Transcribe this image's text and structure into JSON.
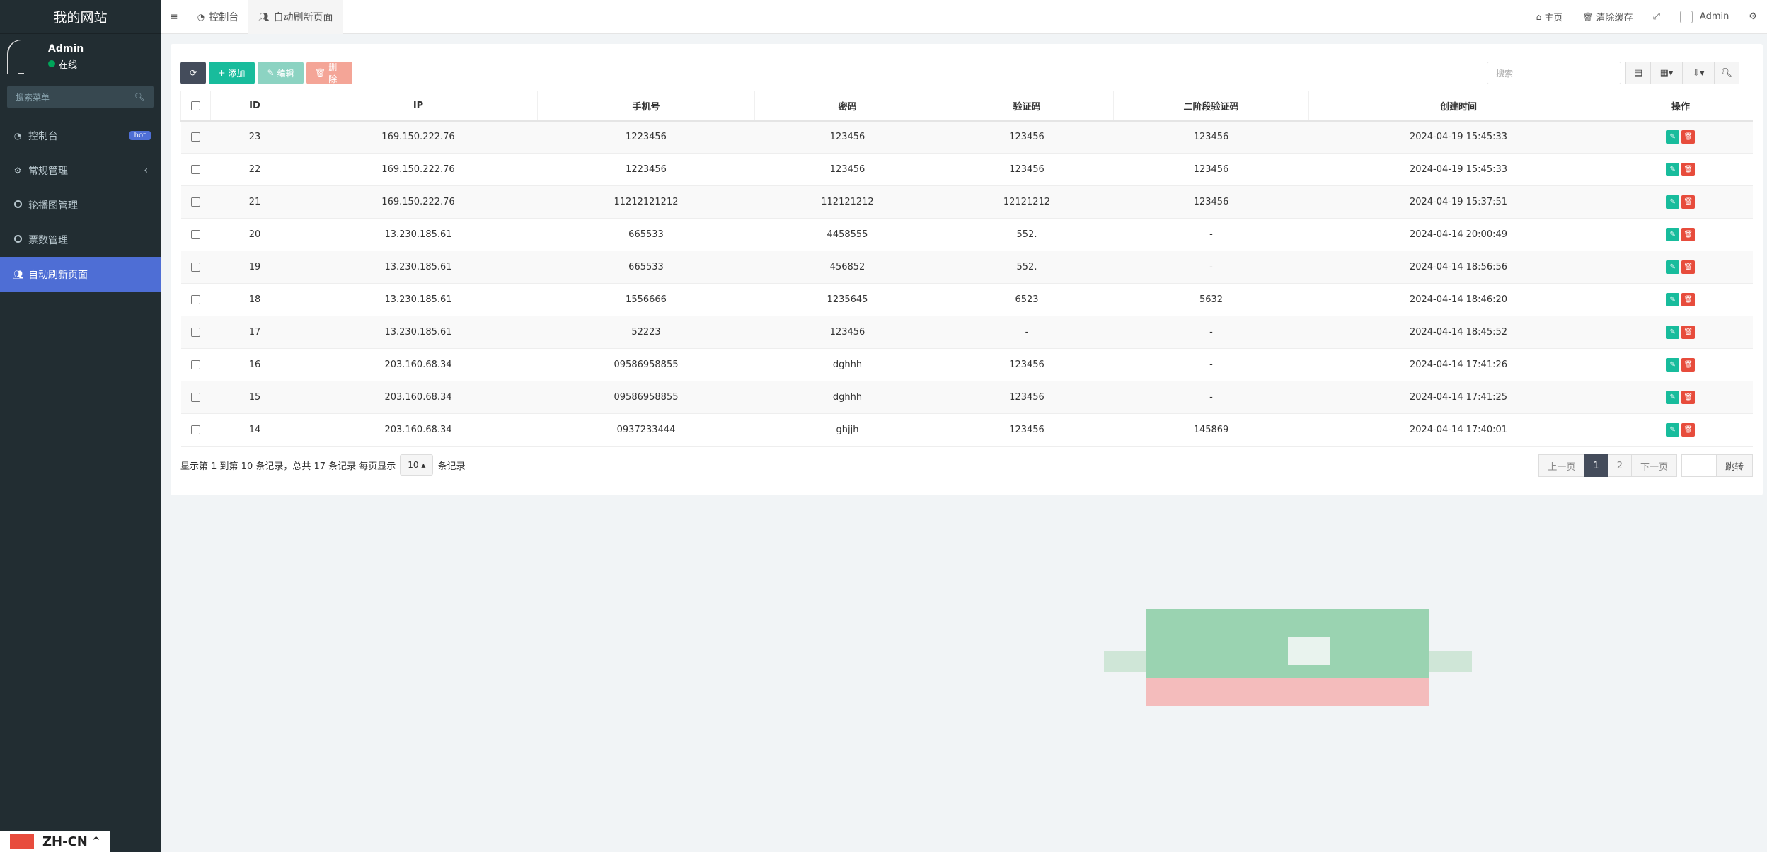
{
  "sidebar": {
    "brand": "我的网站",
    "user": {
      "name": "Admin",
      "status": "在线"
    },
    "search_placeholder": "搜索菜单",
    "items": [
      {
        "label": "控制台",
        "badge": "hot"
      },
      {
        "label": "常规管理"
      },
      {
        "label": "轮播图管理"
      },
      {
        "label": "票数管理"
      },
      {
        "label": "自动刷新页面"
      }
    ],
    "lang": "ZH-CN"
  },
  "topbar": {
    "tabs": [
      {
        "label": "控制台"
      },
      {
        "label": "自动刷新页面"
      }
    ],
    "home": "主页",
    "clear_cache": "清除缓存",
    "user": "Admin"
  },
  "toolbar": {
    "add": "添加",
    "edit": "编辑",
    "delete": "删除",
    "search_placeholder": "搜索"
  },
  "table": {
    "headers": [
      "ID",
      "IP",
      "手机号",
      "密码",
      "验证码",
      "二阶段验证码",
      "创建时间",
      "操作"
    ],
    "rows": [
      [
        "23",
        "169.150.222.76",
        "1223456",
        "123456",
        "123456",
        "123456",
        "2024-04-19 15:45:33"
      ],
      [
        "22",
        "169.150.222.76",
        "1223456",
        "123456",
        "123456",
        "123456",
        "2024-04-19 15:45:33"
      ],
      [
        "21",
        "169.150.222.76",
        "11212121212",
        "112121212",
        "12121212",
        "123456",
        "2024-04-19 15:37:51"
      ],
      [
        "20",
        "13.230.185.61",
        "665533",
        "4458555",
        "552.",
        "-",
        "2024-04-14 20:00:49"
      ],
      [
        "19",
        "13.230.185.61",
        "665533",
        "456852",
        "552.",
        "-",
        "2024-04-14 18:56:56"
      ],
      [
        "18",
        "13.230.185.61",
        "1556666",
        "1235645",
        "6523",
        "5632",
        "2024-04-14 18:46:20"
      ],
      [
        "17",
        "13.230.185.61",
        "52223",
        "123456",
        "-",
        "-",
        "2024-04-14 18:45:52"
      ],
      [
        "16",
        "203.160.68.34",
        "09586958855",
        "dghhh",
        "123456",
        "-",
        "2024-04-14 17:41:26"
      ],
      [
        "15",
        "203.160.68.34",
        "09586958855",
        "dghhh",
        "123456",
        "-",
        "2024-04-14 17:41:25"
      ],
      [
        "14",
        "203.160.68.34",
        "0937233444",
        "ghjjh",
        "123456",
        "145869",
        "2024-04-14 17:40:01"
      ]
    ]
  },
  "footer": {
    "summary": "显示第 1 到第 10 条记录，总共 17 条记录 每页显示",
    "page_size": "10",
    "suffix": "条记录"
  },
  "pager": {
    "prev": "上一页",
    "pages": [
      "1",
      "2"
    ],
    "next": "下一页",
    "go": "跳转"
  }
}
